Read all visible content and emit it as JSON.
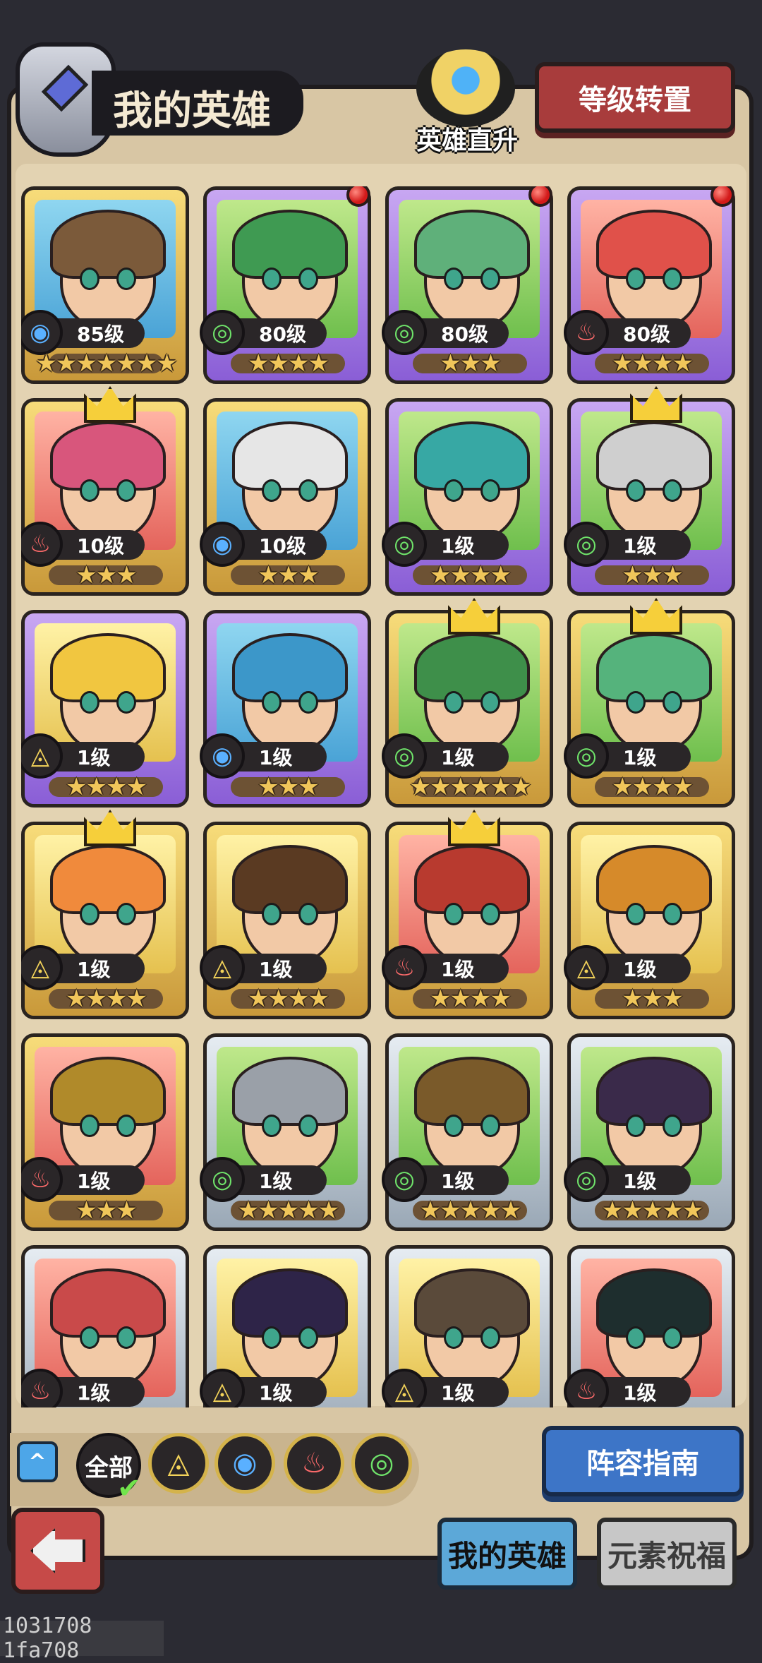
{
  "header": {
    "title": "我的英雄",
    "direct_upgrade_label": "英雄直升",
    "level_reset_label": "等级转置"
  },
  "heroes": [
    {
      "level": "85级",
      "element": "water",
      "frame": "gold",
      "bg": "blue",
      "stars": "★★★★★★★",
      "crown": false,
      "reddot": false
    },
    {
      "level": "80级",
      "element": "wind",
      "frame": "purple",
      "bg": "green",
      "stars": "★★★★",
      "crown": false,
      "reddot": true
    },
    {
      "level": "80级",
      "element": "wind",
      "frame": "purple",
      "bg": "green",
      "stars": "★★★",
      "crown": false,
      "reddot": true
    },
    {
      "level": "80级",
      "element": "fire",
      "frame": "purple",
      "bg": "red",
      "stars": "★★★★",
      "crown": false,
      "reddot": true
    },
    {
      "level": "10级",
      "element": "fire",
      "frame": "gold",
      "bg": "red",
      "stars": "★★★",
      "crown": true,
      "reddot": false
    },
    {
      "level": "10级",
      "element": "water",
      "frame": "gold",
      "bg": "blue",
      "stars": "★★★",
      "crown": false,
      "reddot": false
    },
    {
      "level": "1级",
      "element": "wind",
      "frame": "purple",
      "bg": "green",
      "stars": "★★★★",
      "crown": false,
      "reddot": false
    },
    {
      "level": "1级",
      "element": "wind",
      "frame": "purple",
      "bg": "green",
      "stars": "★★★",
      "crown": true,
      "reddot": false
    },
    {
      "level": "1级",
      "element": "earth",
      "frame": "purple",
      "bg": "yellow",
      "stars": "★★★★",
      "crown": false,
      "reddot": false
    },
    {
      "level": "1级",
      "element": "water",
      "frame": "purple",
      "bg": "blue",
      "stars": "★★★",
      "crown": false,
      "reddot": false
    },
    {
      "level": "1级",
      "element": "wind",
      "frame": "gold",
      "bg": "green",
      "stars": "★★★★★★",
      "crown": true,
      "reddot": false
    },
    {
      "level": "1级",
      "element": "wind",
      "frame": "gold",
      "bg": "green",
      "stars": "★★★★",
      "crown": true,
      "reddot": false
    },
    {
      "level": "1级",
      "element": "earth",
      "frame": "gold",
      "bg": "yellow",
      "stars": "★★★★",
      "crown": true,
      "reddot": false
    },
    {
      "level": "1级",
      "element": "earth",
      "frame": "gold",
      "bg": "yellow",
      "stars": "★★★★",
      "crown": false,
      "reddot": false
    },
    {
      "level": "1级",
      "element": "fire",
      "frame": "gold",
      "bg": "red",
      "stars": "★★★★",
      "crown": true,
      "reddot": false
    },
    {
      "level": "1级",
      "element": "earth",
      "frame": "gold",
      "bg": "yellow",
      "stars": "★★★",
      "crown": false,
      "reddot": false
    },
    {
      "level": "1级",
      "element": "fire",
      "frame": "gold",
      "bg": "red",
      "stars": "★★★",
      "crown": false,
      "reddot": false
    },
    {
      "level": "1级",
      "element": "wind",
      "frame": "silver",
      "bg": "green",
      "stars": "★★★★★",
      "crown": false,
      "reddot": false
    },
    {
      "level": "1级",
      "element": "wind",
      "frame": "silver",
      "bg": "green",
      "stars": "★★★★★",
      "crown": false,
      "reddot": false
    },
    {
      "level": "1级",
      "element": "wind",
      "frame": "silver",
      "bg": "green",
      "stars": "★★★★★",
      "crown": false,
      "reddot": false
    },
    {
      "level": "1级",
      "element": "fire",
      "frame": "silver",
      "bg": "red",
      "stars": "",
      "crown": false,
      "reddot": false
    },
    {
      "level": "1级",
      "element": "earth",
      "frame": "silver",
      "bg": "yellow",
      "stars": "",
      "crown": false,
      "reddot": false
    },
    {
      "level": "1级",
      "element": "earth",
      "frame": "silver",
      "bg": "yellow",
      "stars": "",
      "crown": false,
      "reddot": false
    },
    {
      "level": "1级",
      "element": "fire",
      "frame": "silver",
      "bg": "red",
      "stars": "",
      "crown": false,
      "reddot": false
    }
  ],
  "filter": {
    "all_label": "全部",
    "elements": [
      "earth",
      "water",
      "fire",
      "wind"
    ]
  },
  "guide_label": "阵容指南",
  "tabs": {
    "my_heroes": "我的英雄",
    "element_blessing": "元素祝福"
  },
  "watermark": "1031708 1fa708",
  "element_glyphs": {
    "water": "◉",
    "fire": "♨",
    "wind": "◎",
    "earth": "◬"
  }
}
